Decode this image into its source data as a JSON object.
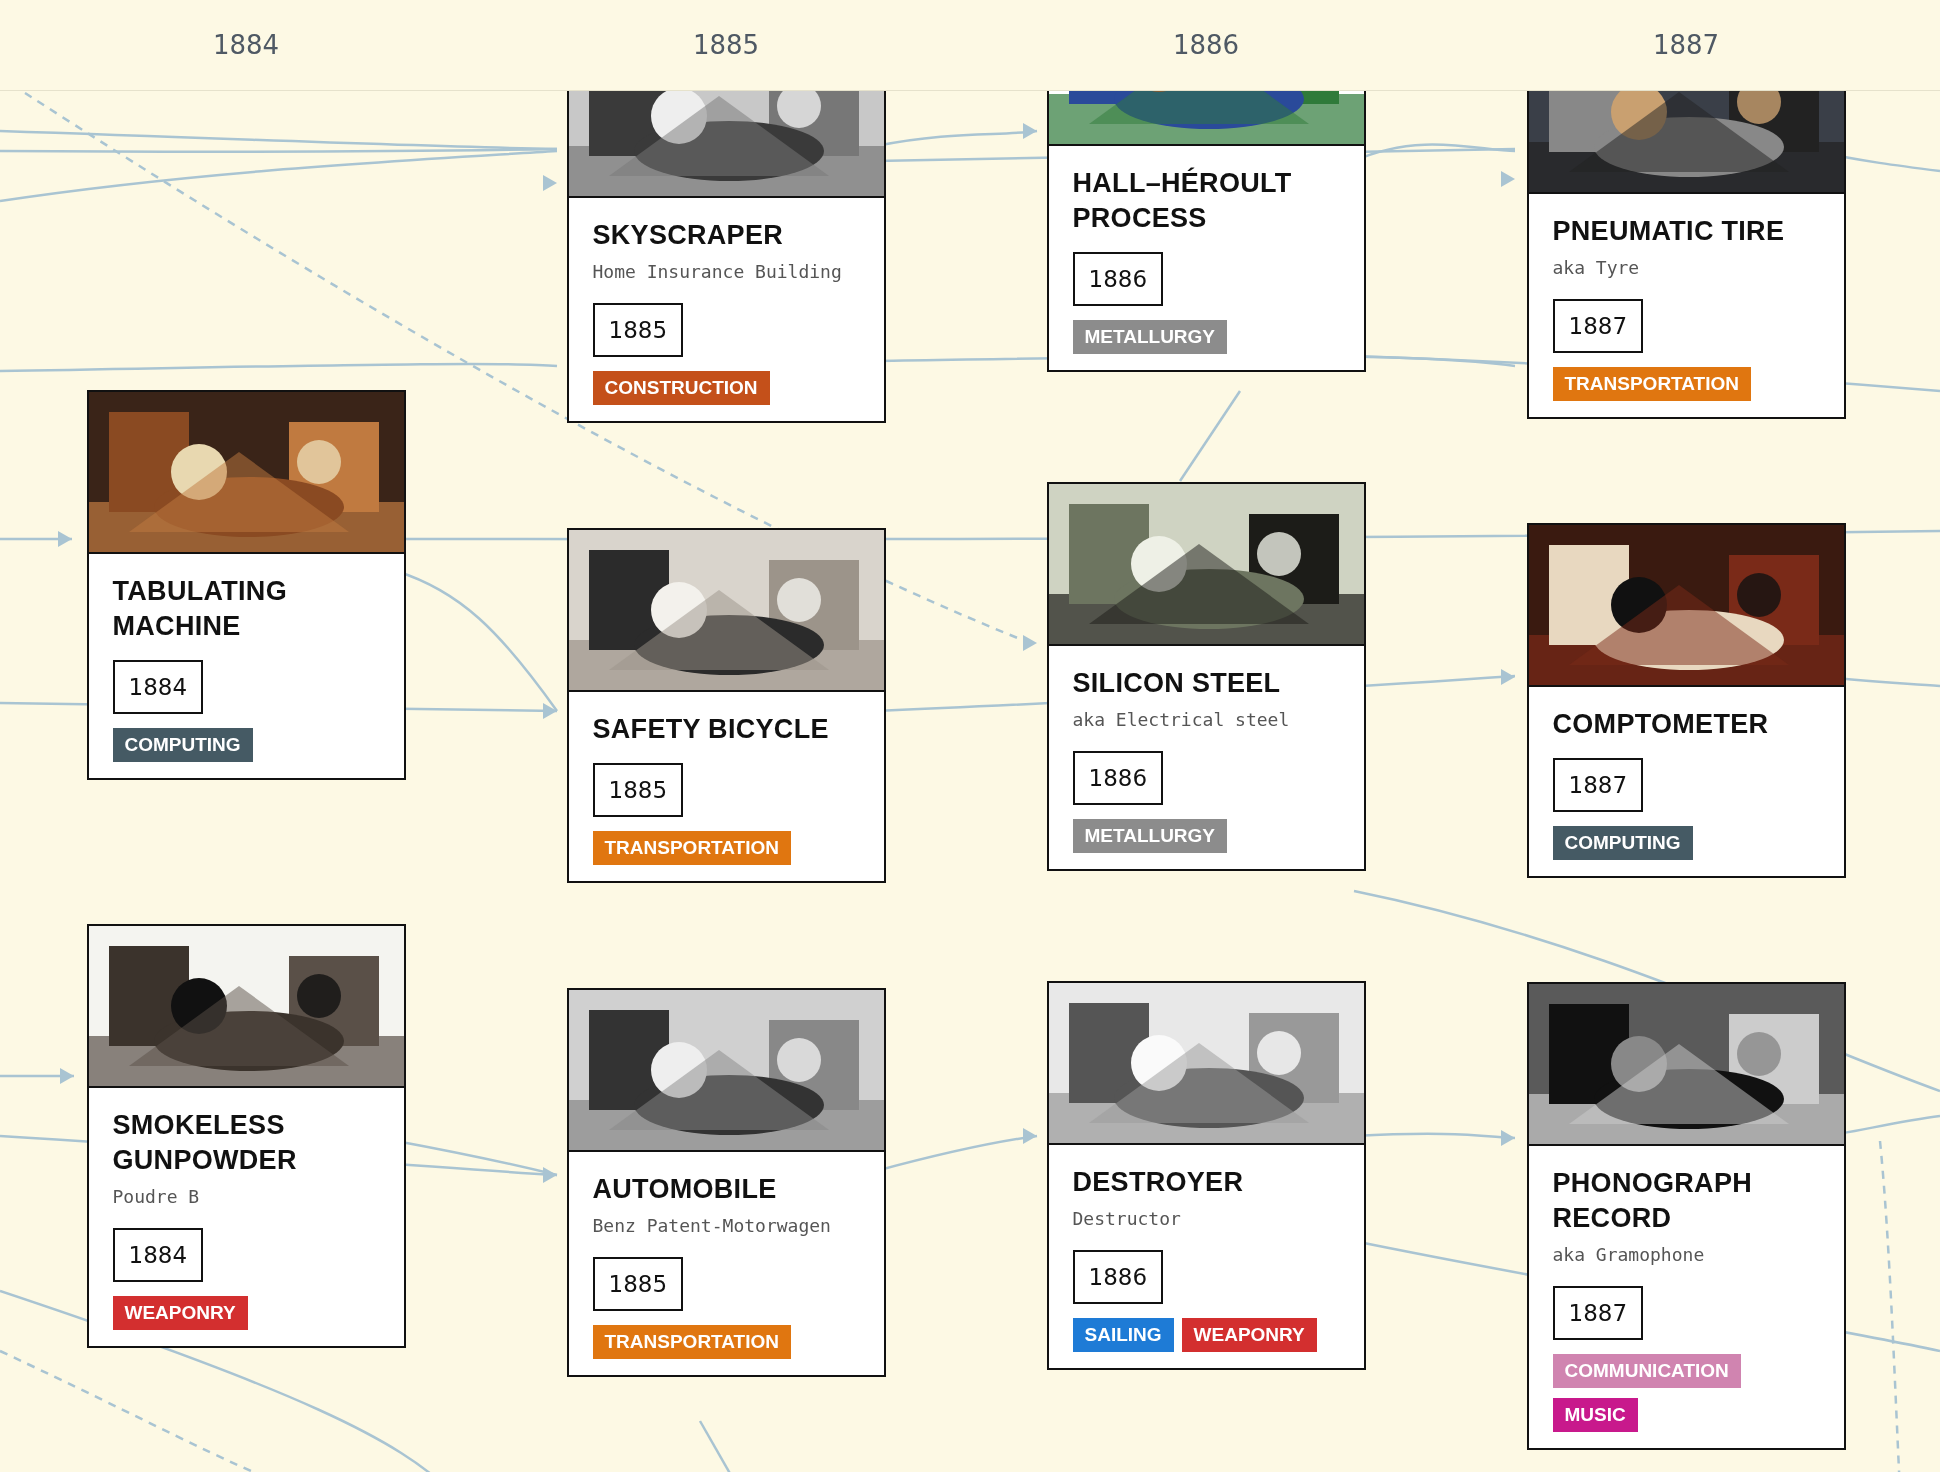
{
  "years": [
    "1884",
    "1885",
    "1886",
    "1887"
  ],
  "columns": [
    {
      "cards": [
        {
          "title": "TABULATING MACHINE",
          "year": "1884",
          "tags": [
            {
              "label": "COMPUTING",
              "color": "#455a64"
            }
          ]
        },
        {
          "title": "SMOKELESS GUNPOWDER",
          "subtitle": "Poudre B",
          "year": "1884",
          "tags": [
            {
              "label": "WEAPONRY",
              "color": "#d32f2f"
            }
          ]
        }
      ]
    },
    {
      "cards": [
        {
          "title": "SKYSCRAPER",
          "subtitle": "Home Insurance Building",
          "year": "1885",
          "tags": [
            {
              "label": "CONSTRUCTION",
              "color": "#c4501a"
            }
          ]
        },
        {
          "title": "SAFETY BICYCLE",
          "year": "1885",
          "tags": [
            {
              "label": "TRANSPORTATION",
              "color": "#e07610"
            }
          ]
        },
        {
          "title": "AUTOMOBILE",
          "subtitle": "Benz Patent-Motorwagen",
          "year": "1885",
          "tags": [
            {
              "label": "TRANSPORTATION",
              "color": "#e07610"
            }
          ]
        }
      ]
    },
    {
      "cards": [
        {
          "title": "HALL–HÉROULT PROCESS",
          "year": "1886",
          "tags": [
            {
              "label": "METALLURGY",
              "color": "#8c8c8c"
            }
          ]
        },
        {
          "title": "SILICON STEEL",
          "subtitle": "aka Electrical steel",
          "year": "1886",
          "tags": [
            {
              "label": "METALLURGY",
              "color": "#8c8c8c"
            }
          ]
        },
        {
          "title": "DESTROYER",
          "subtitle": "Destructor",
          "year": "1886",
          "tags": [
            {
              "label": "SAILING",
              "color": "#1e7bd6"
            },
            {
              "label": "WEAPONRY",
              "color": "#d32f2f"
            }
          ]
        }
      ]
    },
    {
      "cards": [
        {
          "title": "PNEUMATIC TIRE",
          "subtitle": "aka Tyre",
          "year": "1887",
          "tags": [
            {
              "label": "TRANSPORTATION",
              "color": "#e07610"
            }
          ]
        },
        {
          "title": "COMPTOMETER",
          "year": "1887",
          "tags": [
            {
              "label": "COMPUTING",
              "color": "#455a64"
            }
          ]
        },
        {
          "title": "PHONOGRAPH RECORD",
          "subtitle": "aka Gramophone",
          "year": "1887",
          "tags": [
            {
              "label": "COMMUNICATION",
              "color": "#d084b0"
            },
            {
              "label": "MUSIC",
              "color": "#c8198c"
            }
          ]
        }
      ]
    }
  ]
}
